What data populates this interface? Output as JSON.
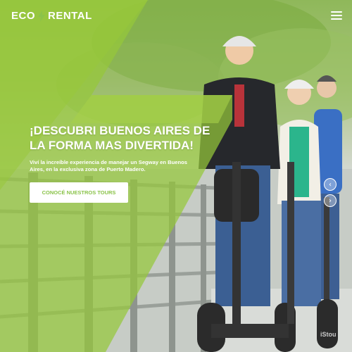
{
  "header": {
    "logo_left": "ECO",
    "logo_right": "RENTAL",
    "menu_icon": "hamburger-menu-icon"
  },
  "hero": {
    "headline_line1": "¡DESCUBRI BUENOS AIRES DE",
    "headline_line2": "LA FORMA MAS DIVERTIDA!",
    "subtext_line1": "Viví la increíble experiencia de manejar un Segway en Buenos",
    "subtext_line2": "Aires, en la exclusiva zona de Puerto Madero.",
    "cta_label": "CONOCÉ NUESTROS TOURS"
  },
  "slider": {
    "prev_icon": "chevron-left-icon",
    "next_icon": "chevron-right-icon"
  },
  "watermark": "iStou",
  "colors": {
    "brand_green": "#8bc34a",
    "overlay_green": "#9ccc3c",
    "text": "#ffffff"
  }
}
